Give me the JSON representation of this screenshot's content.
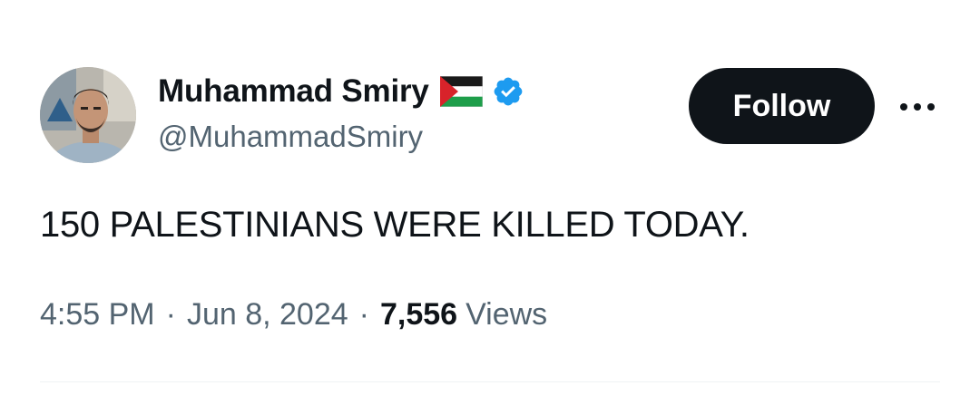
{
  "author": {
    "display_name": "Muhammad Smiry",
    "handle": "@MuhammadSmiry",
    "flag_icon": "palestine-flag-icon",
    "verified_icon": "verified-badge-icon",
    "verified_color": "#1d9bf0"
  },
  "actions": {
    "follow_label": "Follow",
    "more_icon": "more-options-icon"
  },
  "tweet": {
    "text": "150 PALESTINIANS WERE KILLED TODAY."
  },
  "meta": {
    "time": "4:55 PM",
    "separator": "·",
    "date": "Jun 8, 2024",
    "views_count": "7,556",
    "views_label": "Views"
  },
  "colors": {
    "text_primary": "#0f1419",
    "text_secondary": "#536471",
    "button_bg": "#0f1419",
    "divider": "#eff3f4"
  }
}
